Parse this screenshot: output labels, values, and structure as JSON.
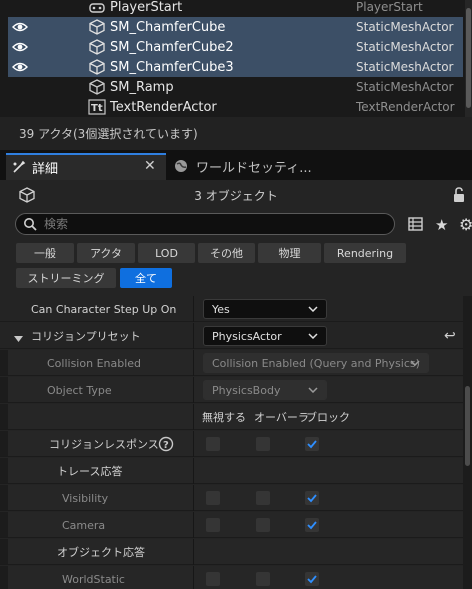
{
  "outliner": {
    "rows": [
      {
        "name": "PlayerStart",
        "type": "PlayerStart",
        "selected": false,
        "visible": false,
        "icon": "player-start-icon"
      },
      {
        "name": "SM_ChamferCube",
        "type": "StaticMeshActor",
        "selected": true,
        "visible": true,
        "icon": "static-mesh-icon"
      },
      {
        "name": "SM_ChamferCube2",
        "type": "StaticMeshActor",
        "selected": true,
        "visible": true,
        "icon": "static-mesh-icon"
      },
      {
        "name": "SM_ChamferCube3",
        "type": "StaticMeshActor",
        "selected": true,
        "visible": true,
        "icon": "static-mesh-icon"
      },
      {
        "name": "SM_Ramp",
        "type": "StaticMeshActor",
        "selected": false,
        "visible": false,
        "icon": "static-mesh-icon"
      },
      {
        "name": "TextRenderActor",
        "type": "TextRenderActor",
        "selected": false,
        "visible": false,
        "icon": "text-render-icon"
      }
    ],
    "status": "39 アクタ(3個選択されています)"
  },
  "tabs": {
    "details": "詳細",
    "world": "ワールドセッティ..."
  },
  "details": {
    "object_count": "3 オブジェクト",
    "search_placeholder": "検索",
    "filters": [
      "一般",
      "アクタ",
      "LOD",
      "その他",
      "物理",
      "Rendering",
      "ストリーミング",
      "全て"
    ],
    "active_filter": "全て",
    "props": {
      "step_up_label": "Can Character Step Up On",
      "step_up_value": "Yes",
      "collision_preset_label": "コリジョンプリセット",
      "collision_preset_value": "PhysicsActor",
      "collision_enabled_label": "Collision Enabled",
      "collision_enabled_value": "Collision Enabled (Query and Physics)",
      "object_type_label": "Object Type",
      "object_type_value": "PhysicsBody",
      "col_ignore": "無視する",
      "col_overlap": "オーバーラ",
      "col_block": "ブロック",
      "responses_label": "コリジョンレスポンス",
      "trace_label": "トレース応答",
      "visibility_label": "Visibility",
      "camera_label": "Camera",
      "object_resp_label": "オブジェクト応答",
      "worldstatic_label": "WorldStatic"
    }
  },
  "colors": {
    "selection": "#3c4f66",
    "accent": "#0f6fdf",
    "checkmark": "#2f8fff"
  }
}
